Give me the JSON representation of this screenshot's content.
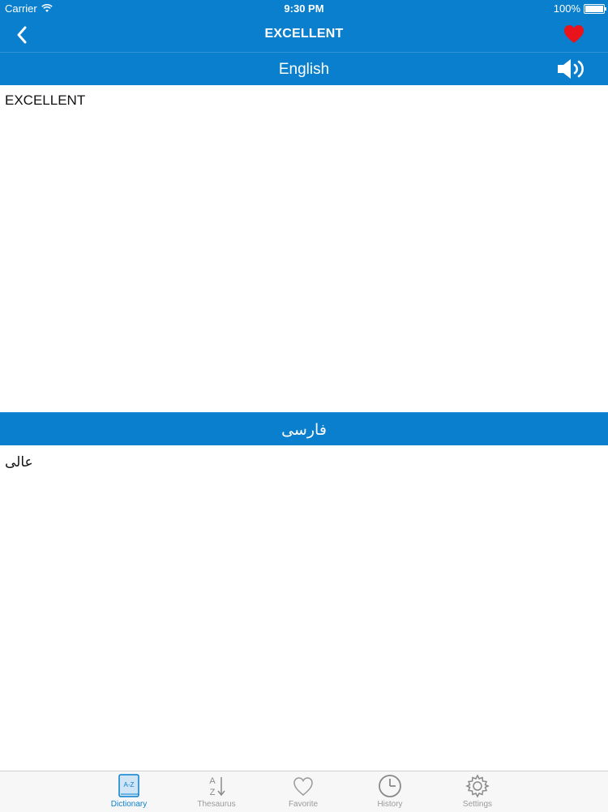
{
  "status": {
    "carrier": "Carrier",
    "time": "9:30 PM",
    "battery": "100%"
  },
  "nav": {
    "title": "EXCELLENT"
  },
  "english": {
    "header": "English",
    "text": "EXCELLENT"
  },
  "farsi": {
    "header": "فارسی",
    "text": "عالی"
  },
  "tabs": [
    {
      "label": "Dictionary",
      "icon": "dictionary-icon",
      "active": true
    },
    {
      "label": "Thesaurus",
      "icon": "thesaurus-icon",
      "active": false
    },
    {
      "label": "Favorite",
      "icon": "heart-outline-icon",
      "active": false
    },
    {
      "label": "History",
      "icon": "clock-icon",
      "active": false
    },
    {
      "label": "Settings",
      "icon": "gear-icon",
      "active": false
    }
  ],
  "colors": {
    "primary": "#0a7fce",
    "favorite": "#e8131b",
    "tab_inactive": "#9a9a9a"
  }
}
